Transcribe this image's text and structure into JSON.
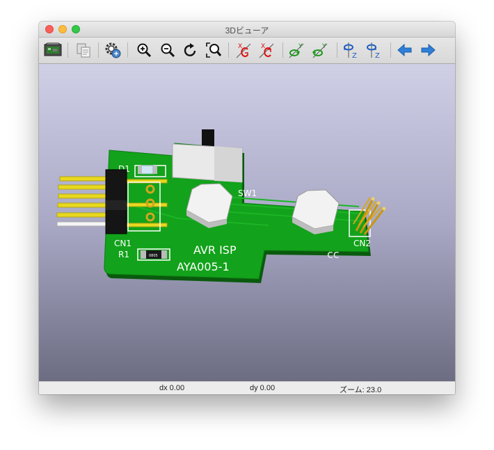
{
  "window": {
    "title": "3Dビューア"
  },
  "toolbar": {
    "buttons": [
      {
        "name": "reload-board-button",
        "icon": "reload-board-icon"
      },
      {
        "name": "copy-image-button",
        "icon": "copy-image-icon"
      },
      {
        "name": "options-button",
        "icon": "gear-icon"
      },
      {
        "name": "zoom-in-button",
        "icon": "zoom-in-icon"
      },
      {
        "name": "zoom-out-button",
        "icon": "zoom-out-icon"
      },
      {
        "name": "redraw-button",
        "icon": "redraw-icon"
      },
      {
        "name": "zoom-fit-button",
        "icon": "zoom-fit-icon"
      },
      {
        "name": "rotate-x-cw-button",
        "icon": "rotate-x-cw-icon",
        "text": "X"
      },
      {
        "name": "rotate-x-ccw-button",
        "icon": "rotate-x-ccw-icon",
        "text": "X"
      },
      {
        "name": "rotate-y-cw-button",
        "icon": "rotate-y-cw-icon",
        "text": "Y"
      },
      {
        "name": "rotate-y-ccw-button",
        "icon": "rotate-y-ccw-icon",
        "text": "Y"
      },
      {
        "name": "rotate-z-cw-button",
        "icon": "rotate-z-cw-icon",
        "text": "Z"
      },
      {
        "name": "rotate-z-ccw-button",
        "icon": "rotate-z-ccw-icon",
        "text": "Z"
      },
      {
        "name": "move-left-button",
        "icon": "arrow-left-icon"
      },
      {
        "name": "move-right-button",
        "icon": "arrow-right-icon"
      }
    ]
  },
  "board": {
    "labels": {
      "d1": "D1",
      "cn1": "CN1",
      "r1": "R1",
      "r1_value": "0805",
      "sw1": "SW1",
      "cn2": "CN2",
      "title": "AVR ISP",
      "part": "AYA005-1"
    },
    "colors": {
      "pcb": "#12a31b",
      "silk": "#ffffff",
      "pin": "#e8d91f",
      "gold": "#c8960c"
    }
  },
  "status": {
    "dx": "dx 0.00",
    "dy": "dy 0.00",
    "zoom": "ズーム: 23.0"
  }
}
